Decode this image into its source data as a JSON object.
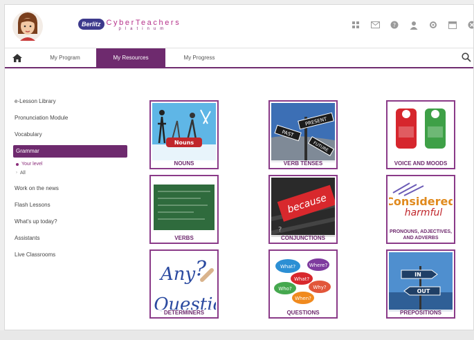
{
  "brand": {
    "badge": "Berlitz",
    "name": "CyberTeachers",
    "sub": "platinum"
  },
  "nav": {
    "items": [
      {
        "label": "My Program"
      },
      {
        "label": "My Resources"
      },
      {
        "label": "My Progress"
      }
    ],
    "active_index": 1
  },
  "sidebar": {
    "items": [
      {
        "label": "e-Lesson Library"
      },
      {
        "label": "Pronunciation Module"
      },
      {
        "label": "Vocabulary"
      },
      {
        "label": "Grammar"
      },
      {
        "label": "Your level"
      },
      {
        "label": "All"
      },
      {
        "label": "Work on the news"
      },
      {
        "label": "Flash Lessons"
      },
      {
        "label": "What's up today?"
      },
      {
        "label": "Assistants"
      },
      {
        "label": "Live Classrooms"
      }
    ]
  },
  "tiles": [
    {
      "label": "NOUNS",
      "image_text": "Nouns"
    },
    {
      "label": "VERB TENSES",
      "image_text": "PAST / PRESENT / FUTURE"
    },
    {
      "label": "VOICE AND MOODS"
    },
    {
      "label": "VERBS"
    },
    {
      "label": "CONJUNCTIONS",
      "image_text": "because"
    },
    {
      "label": "PRONOUNS, ADJECTIVES, AND ADVERBS",
      "image_text": "Considered harmful"
    },
    {
      "label": "DETERMINERS",
      "image_text": "Any Question"
    },
    {
      "label": "QUESTIONS",
      "image_text": "What? Where? Why? Who? When?"
    },
    {
      "label": "PREPOSITIONS",
      "image_text": "IN / OUT"
    }
  ],
  "icons": [
    "home-icon",
    "search-icon",
    "grid-icon",
    "mail-icon",
    "help-icon",
    "user-icon",
    "settings-icon",
    "calendar-icon",
    "close-icon"
  ],
  "colors": {
    "accent": "#6e2a6e",
    "brand_pink": "#b5308a",
    "brand_blue": "#3d3a8c"
  }
}
